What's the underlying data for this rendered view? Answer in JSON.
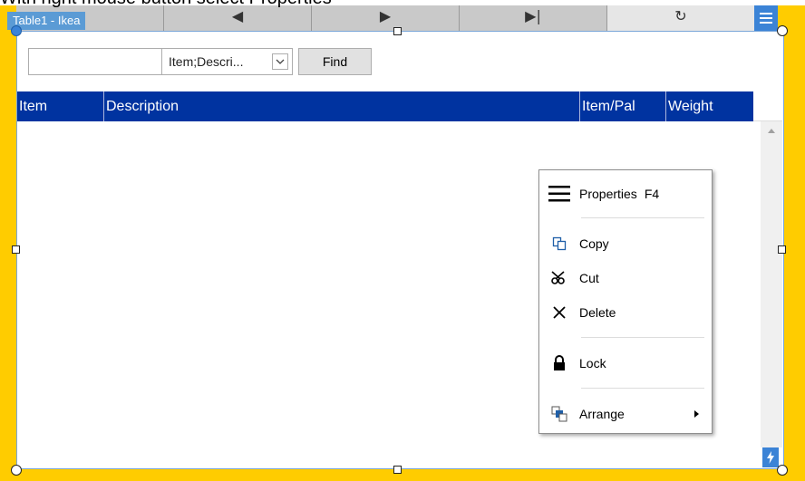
{
  "caption": "With right mouse button select Properties",
  "window": {
    "title": "Table1 - Ikea"
  },
  "nav": {
    "buttons": [
      {
        "name": "nav-first",
        "glyph": ""
      },
      {
        "name": "nav-prev",
        "glyph": "◀"
      },
      {
        "name": "nav-next",
        "glyph": "▶"
      },
      {
        "name": "nav-last",
        "glyph": "▶|"
      },
      {
        "name": "nav-refresh",
        "glyph": "↻"
      }
    ]
  },
  "search": {
    "input_value": "",
    "field_selected": "Item;Descri...",
    "find_label": "Find"
  },
  "table": {
    "columns": [
      "Item",
      "Description",
      "Item/Pal",
      "Weight"
    ],
    "rows": []
  },
  "context_menu": {
    "properties_label": "Properties",
    "properties_shortcut": "F4",
    "copy_label": "Copy",
    "cut_label": "Cut",
    "delete_label": "Delete",
    "lock_label": "Lock",
    "arrange_label": "Arrange"
  },
  "colors": {
    "frame": "#ffcc00",
    "header": "#0033a0",
    "accent": "#3b83d6",
    "title_tab": "#5b9bd5"
  },
  "icons": {
    "menu": "hamburger-icon",
    "bolt": "lightning-icon",
    "properties": "list-icon",
    "copy": "copy-icon",
    "cut": "scissors-icon",
    "delete": "x-icon",
    "lock": "lock-icon",
    "arrange": "arrange-icon"
  }
}
